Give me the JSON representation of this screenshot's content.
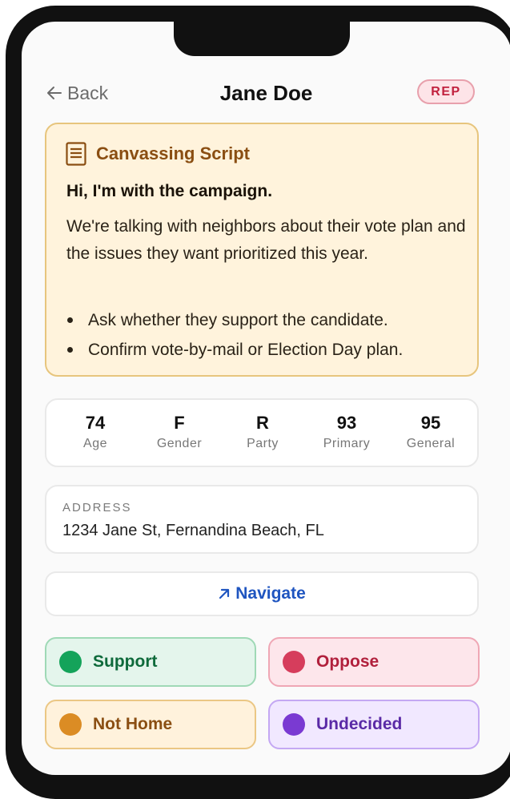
{
  "header": {
    "back_label": "Back",
    "title": "Jane Doe",
    "party_badge": "REP"
  },
  "script": {
    "heading": "Canvassing Script",
    "greeting": "Hi, I'm with the campaign.",
    "body": "We're talking with neighbors about their vote plan and the issues they want prioritized this year.",
    "bullets": [
      "Ask whether they support the candidate.",
      "Confirm vote-by-mail or Election Day plan."
    ]
  },
  "stats": [
    {
      "value": "74",
      "label": "Age"
    },
    {
      "value": "F",
      "label": "Gender"
    },
    {
      "value": "R",
      "label": "Party"
    },
    {
      "value": "93",
      "label": "Primary"
    },
    {
      "value": "95",
      "label": "General"
    }
  ],
  "address": {
    "caption": "ADDRESS",
    "value": "1234 Jane St, Fernandina Beach, FL"
  },
  "navigate_label": "Navigate",
  "actions": {
    "support": "Support",
    "oppose": "Oppose",
    "not_home": "Not Home",
    "undecided": "Undecided"
  },
  "colors": {
    "badge_red": "#c1213e",
    "script_bg": "#fff3dc",
    "script_accent": "#8a4e12",
    "navigate_blue": "#1f55c0",
    "support_green": "#14a35a",
    "oppose_red": "#d63d5c",
    "not_home_orange": "#db8c24",
    "undecided_purple": "#7a3ad2"
  },
  "icons": [
    "arrow-left-icon",
    "document-icon",
    "arrow-up-right-icon"
  ]
}
